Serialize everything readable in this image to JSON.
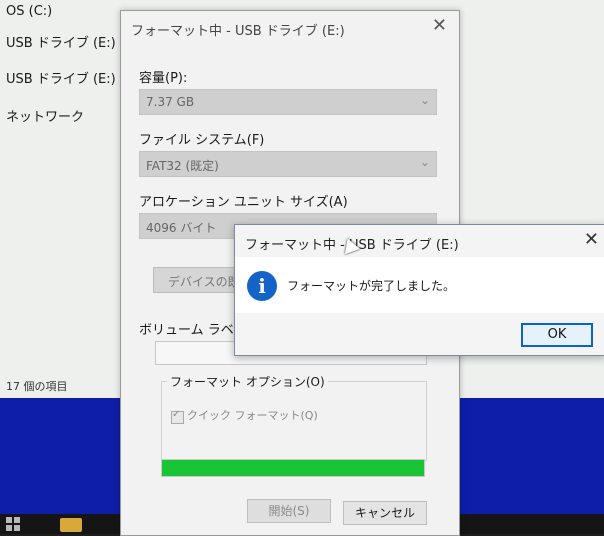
{
  "explorer": {
    "nav_items": [
      "OS (C:)",
      "USB ドライブ (E:)",
      "USB ドライブ (E:)",
      "ネットワーク"
    ],
    "item_count": "17 個の項目"
  },
  "format_dialog": {
    "title": "フォーマット中 - USB ドライブ (E:)",
    "close": "✕",
    "capacity_label": "容量(P):",
    "capacity_value": "7.37 GB",
    "filesystem_label": "ファイル システム(F)",
    "filesystem_value": "FAT32 (既定)",
    "alloc_label": "アロケーション ユニット サイズ(A)",
    "alloc_value": "4096 バイト",
    "restore_button": "デバイスの既",
    "volume_label": "ボリューム ラベル(",
    "format_options_label": "フォーマット オプション(O)",
    "quick_format_label": "クイック フォーマット(Q)",
    "progress_percent": 100,
    "start_button": "開始(S)",
    "cancel_button": "キャンセル"
  },
  "done_dialog": {
    "title": "フォーマット中 - USB ドライブ (E:)",
    "close": "✕",
    "message": "フォーマットが完了しました。",
    "ok_button": "OK",
    "icon": "info-icon"
  },
  "colors": {
    "progress": "#19c436",
    "desktop_blue": "#0f1ea8",
    "info_icon": "#1463c8",
    "ok_border": "#0a64c8"
  }
}
